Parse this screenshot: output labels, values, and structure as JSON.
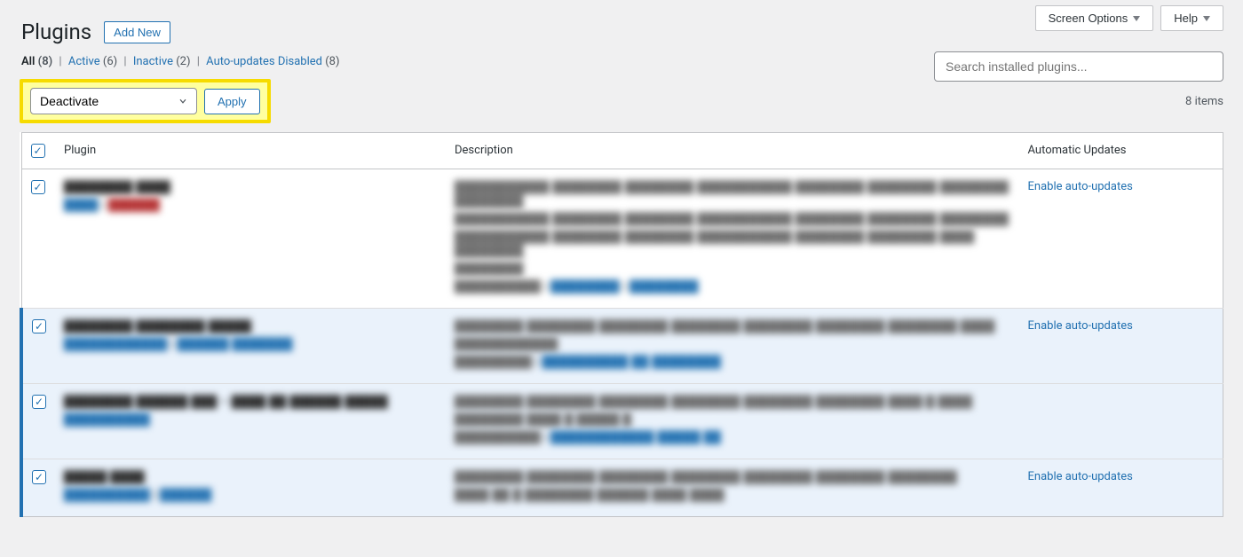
{
  "top": {
    "screen_options": "Screen Options",
    "help": "Help"
  },
  "header": {
    "title": "Plugins",
    "add_new": "Add New"
  },
  "search": {
    "placeholder": "Search installed plugins..."
  },
  "filters": {
    "all": {
      "label": "All",
      "count": "(8)"
    },
    "active": {
      "label": "Active",
      "count": "(6)"
    },
    "inactive": {
      "label": "Inactive",
      "count": "(2)"
    },
    "auto_disabled": {
      "label": "Auto-updates Disabled",
      "count": "(8)"
    }
  },
  "bulk": {
    "selected_action": "Deactivate",
    "apply": "Apply"
  },
  "pagination": {
    "items_label": "8 items"
  },
  "columns": {
    "plugin": "Plugin",
    "description": "Description",
    "auto_updates": "Automatic Updates"
  },
  "auto_update_link": "Enable auto-updates",
  "rows": [
    {
      "active": false,
      "show_auto_link": true
    },
    {
      "active": true,
      "show_auto_link": true
    },
    {
      "active": true,
      "show_auto_link": false
    },
    {
      "active": true,
      "show_auto_link": true
    }
  ]
}
